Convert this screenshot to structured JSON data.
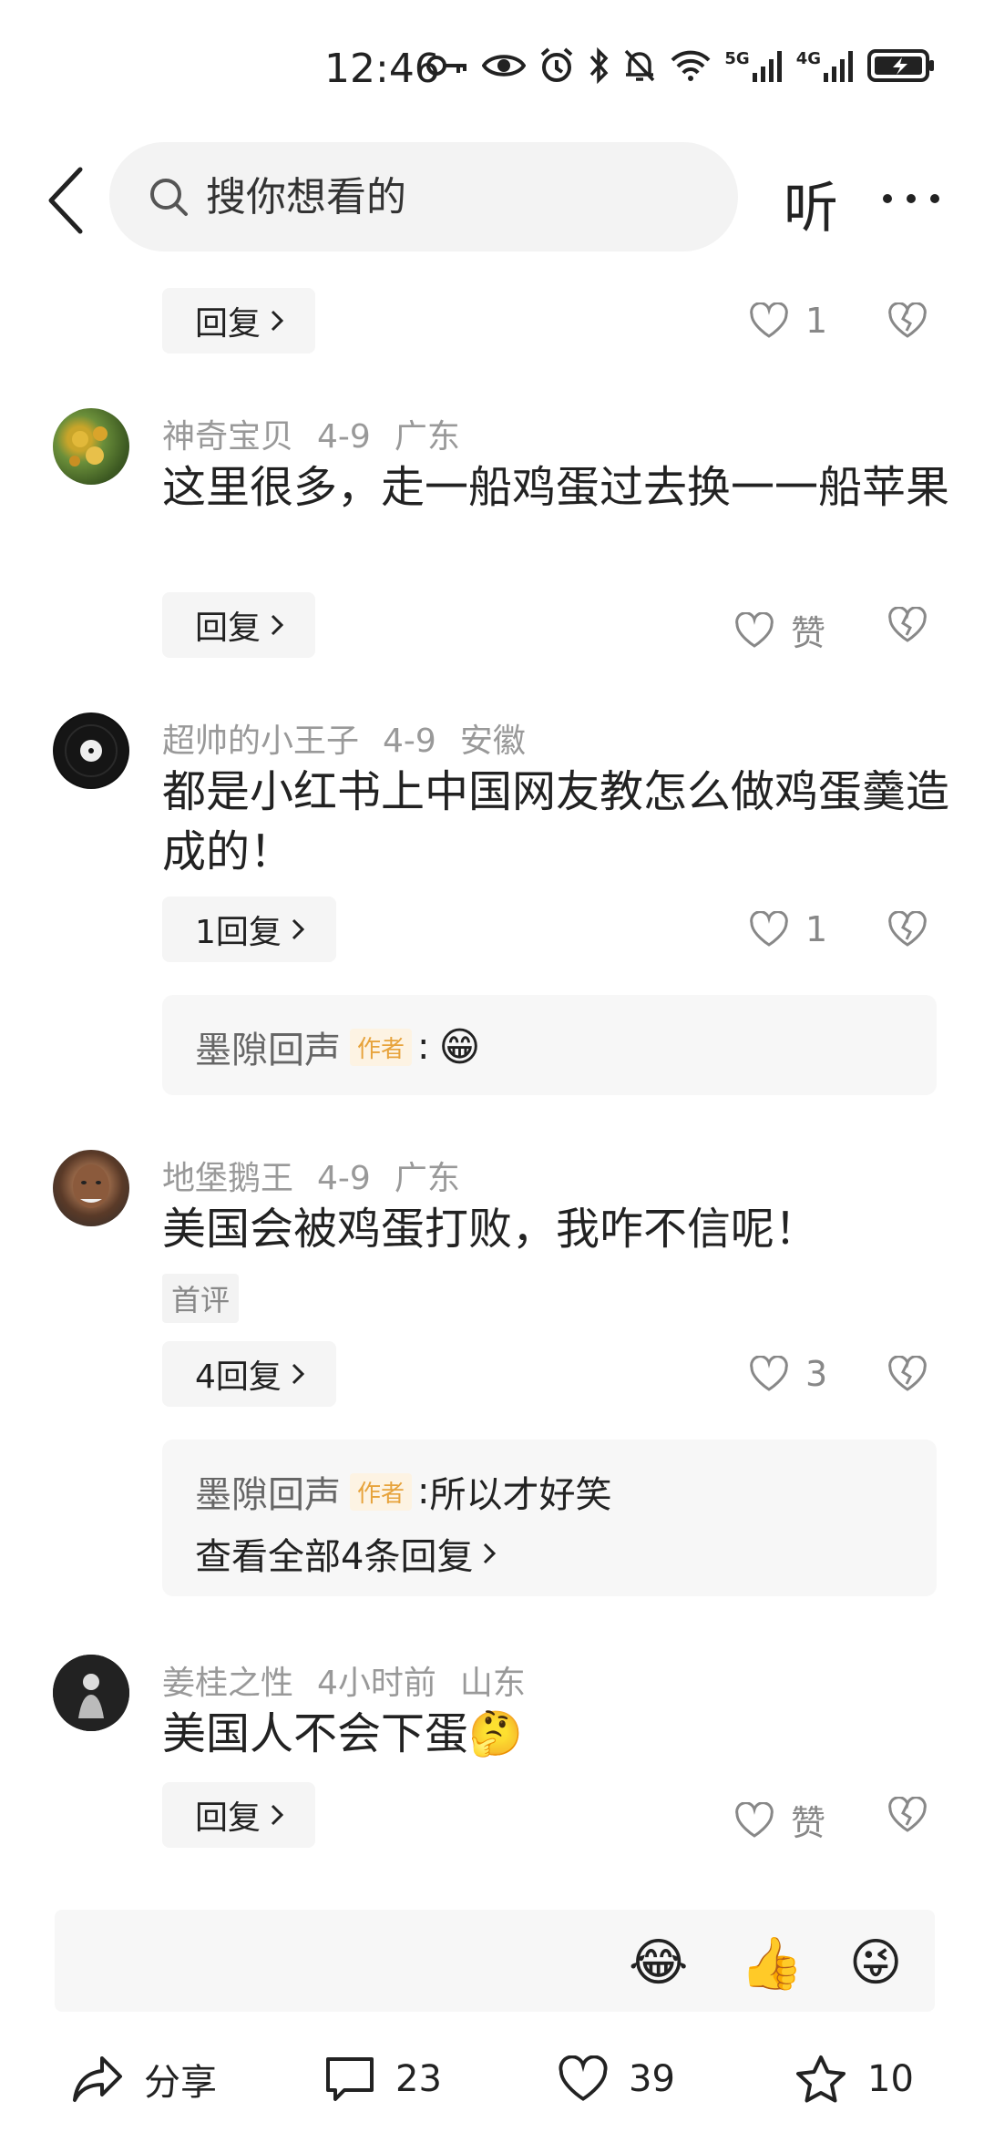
{
  "status": {
    "time": "12:46",
    "net1": "5G",
    "net2": "4G"
  },
  "header": {
    "search_placeholder": "搜你想看的",
    "listen_label": "听"
  },
  "comments": [
    {
      "reply_label": "回复",
      "likes": "1"
    },
    {
      "author": "神奇宝贝",
      "date": "4-9",
      "location": "广东",
      "text": "这里很多，走一船鸡蛋过去换一一船苹果",
      "reply_label": "回复",
      "likes": "赞"
    },
    {
      "author": "超帅的小王子",
      "date": "4-9",
      "location": "安徽",
      "text": "都是小红书上中国网友教怎么做鸡蛋羹造成的！",
      "reply_label": "1回复",
      "likes": "1",
      "nested": {
        "author": "墨隙回声",
        "tag": "作者",
        "colon": ":",
        "emoji": "😁"
      }
    },
    {
      "author": "地堡鹅王",
      "date": "4-9",
      "location": "广东",
      "text": "美国会被鸡蛋打败，我咋不信呢！",
      "badge": "首评",
      "reply_label": "4回复",
      "likes": "3",
      "nested": {
        "author": "墨隙回声",
        "tag": "作者",
        "colon": ":",
        "text": "所以才好笑",
        "view_all": "查看全部4条回复"
      }
    },
    {
      "author": "姜桂之性",
      "date": "4小时前",
      "location": "山东",
      "text": "美国人不会下蛋",
      "emoji": "🤔",
      "reply_label": "回复",
      "likes": "赞"
    }
  ],
  "emoji_bar": [
    "😂",
    "👍",
    "😜"
  ],
  "bottom": {
    "share_label": "分享",
    "comments_count": "23",
    "likes_count": "39",
    "favorites_count": "10"
  }
}
